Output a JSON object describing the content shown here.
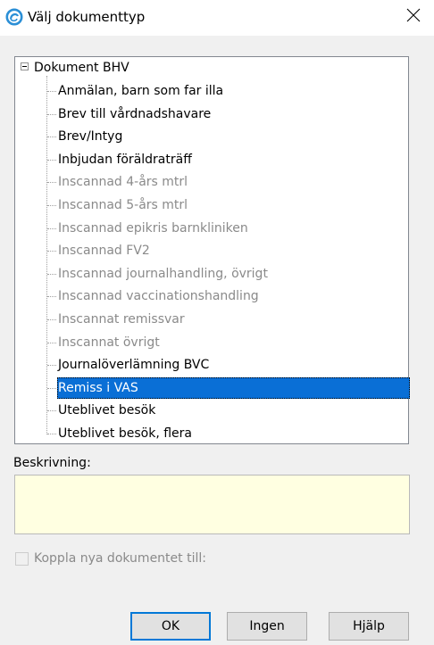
{
  "window": {
    "title": "Välj dokumenttyp",
    "icon": "app-swirl-icon",
    "close_icon": "close-icon"
  },
  "tree": {
    "root": "Dokument BHV",
    "root_expander": "minus-box-icon",
    "items": [
      {
        "label": "Anmälan, barn som far illa",
        "state": "normal"
      },
      {
        "label": "Brev till vårdnadshavare",
        "state": "normal"
      },
      {
        "label": "Brev/Intyg",
        "state": "normal"
      },
      {
        "label": "Inbjudan föräldraträff",
        "state": "normal"
      },
      {
        "label": "Inscannad 4-års mtrl",
        "state": "disabled"
      },
      {
        "label": "Inscannad 5-års mtrl",
        "state": "disabled"
      },
      {
        "label": "Inscannad epikris barnkliniken",
        "state": "disabled"
      },
      {
        "label": "Inscannad FV2",
        "state": "disabled"
      },
      {
        "label": "Inscannad journalhandling, övrigt",
        "state": "disabled"
      },
      {
        "label": "Inscannad vaccinationshandling",
        "state": "disabled"
      },
      {
        "label": "Inscannat remissvar",
        "state": "disabled"
      },
      {
        "label": "Inscannat övrigt",
        "state": "disabled"
      },
      {
        "label": "Journalöverlämning BVC",
        "state": "normal"
      },
      {
        "label": "Remiss i VAS",
        "state": "selected"
      },
      {
        "label": "Uteblivet besök",
        "state": "normal"
      },
      {
        "label": "Uteblivet besök, flera",
        "state": "normal"
      }
    ]
  },
  "description": {
    "label": "Beskrivning:",
    "value": ""
  },
  "link_checkbox": {
    "label": "Koppla nya dokumentet till:",
    "checked": false,
    "enabled": false
  },
  "buttons": {
    "ok": "OK",
    "none": "Ingen",
    "help": "Hjälp"
  },
  "colors": {
    "selection": "#0a6fd6",
    "disabled_text": "#8a8a8a",
    "description_bg": "#ffffe1",
    "dialog_bg": "#f0f0f0",
    "icon_accent": "#2b8fd6"
  }
}
